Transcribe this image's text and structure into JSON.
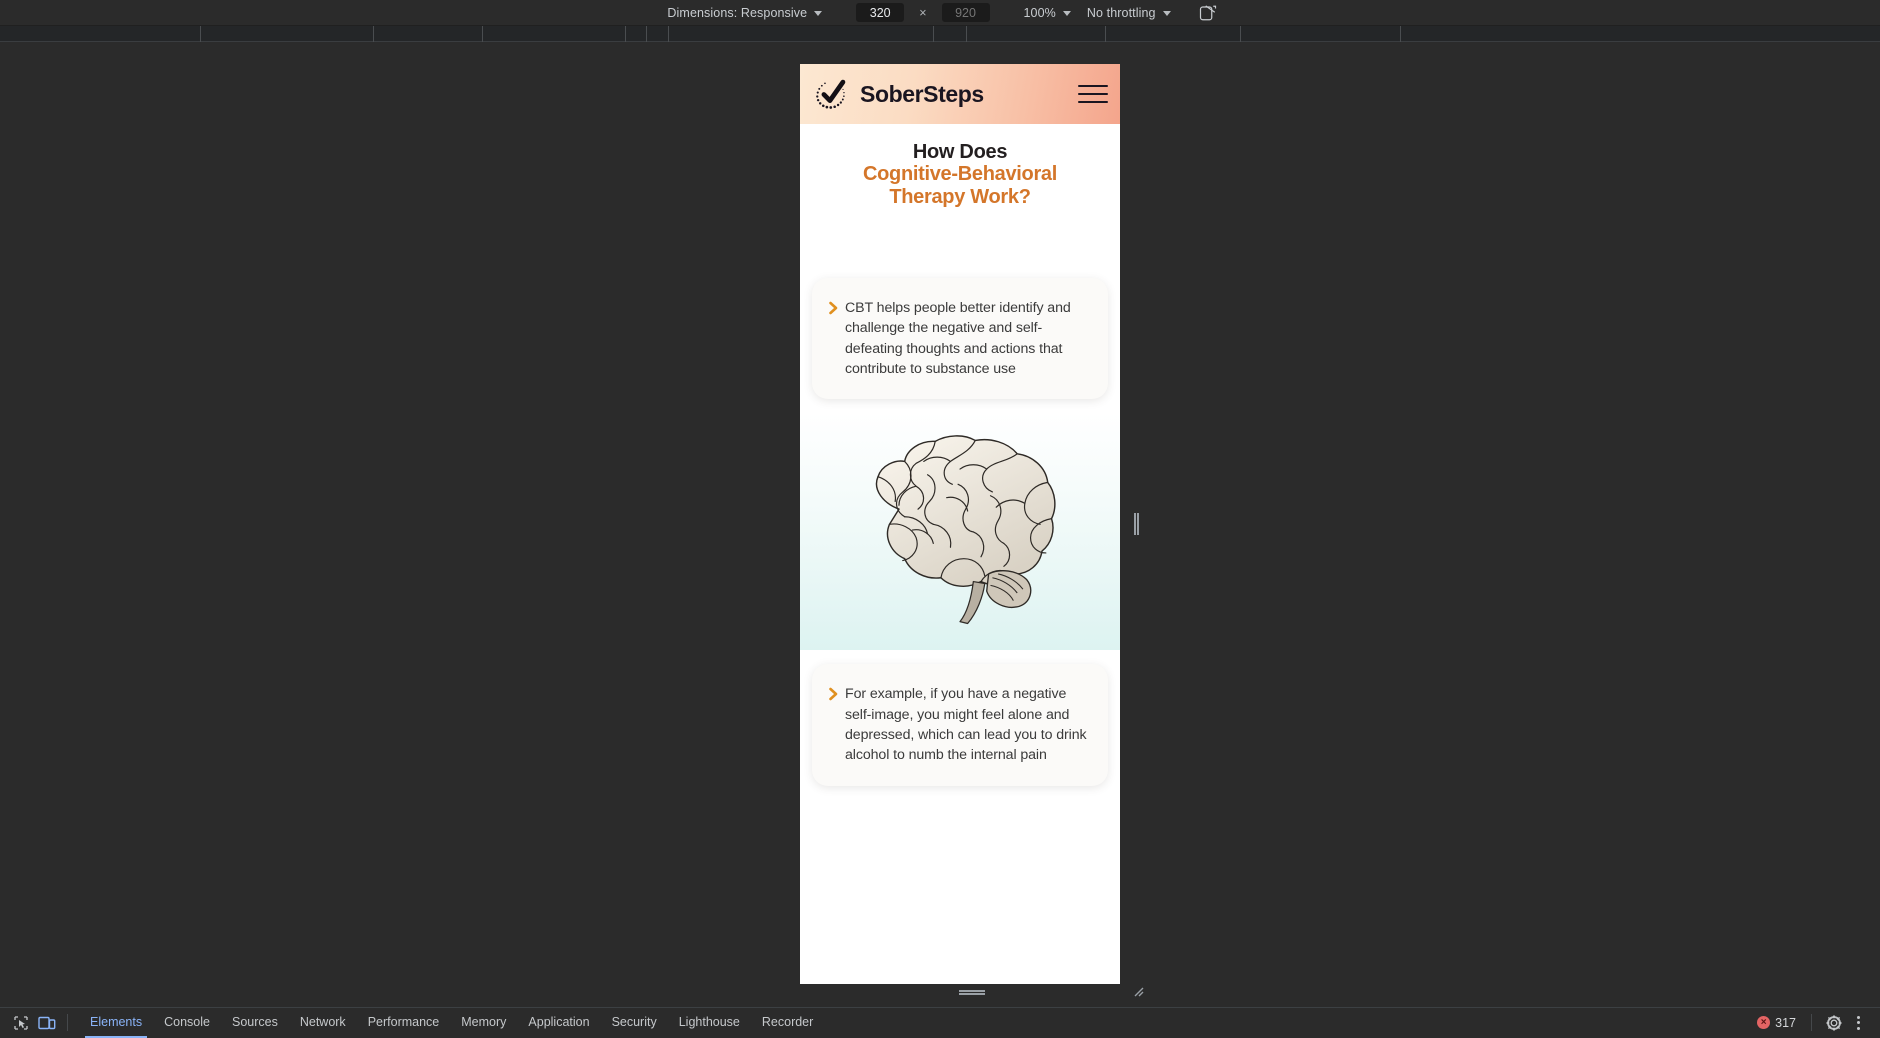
{
  "devtools": {
    "device_toolbar": {
      "dimensions_label": "Dimensions: Responsive",
      "width_value": "320",
      "height_placeholder": "920",
      "multiply_symbol": "×",
      "zoom_label": "100%",
      "throttling_label": "No throttling",
      "rotate_icon": "rotate-device-icon"
    },
    "bottom_bar": {
      "inspect_icon": "inspect-element-icon",
      "device_toolbar_icon": "toggle-device-toolbar-icon",
      "tabs": [
        {
          "label": "Elements",
          "active": true
        },
        {
          "label": "Console",
          "active": false
        },
        {
          "label": "Sources",
          "active": false
        },
        {
          "label": "Network",
          "active": false
        },
        {
          "label": "Performance",
          "active": false
        },
        {
          "label": "Memory",
          "active": false
        },
        {
          "label": "Application",
          "active": false
        },
        {
          "label": "Security",
          "active": false
        },
        {
          "label": "Lighthouse",
          "active": false
        },
        {
          "label": "Recorder",
          "active": false
        }
      ],
      "error_icon": "error-circle-icon",
      "error_count": "317",
      "settings_icon": "gear-icon",
      "more_icon": "kebab-menu-icon"
    }
  },
  "page": {
    "header": {
      "logo_icon": "checkmark-circle-logo-icon",
      "brand": "SoberSteps",
      "menu_icon": "hamburger-menu-icon",
      "gradient_from": "#fce8d2",
      "gradient_to": "#f4a58c"
    },
    "hero": {
      "line1": "How Does",
      "line2": "Cognitive-Behavioral",
      "line3": "Therapy Work?",
      "accent_color": "#d4762a"
    },
    "cards": [
      {
        "bullet_icon": "chevron-right-icon",
        "text": "CBT helps people better identify and challenge the negative and self-defeating thoughts and actions that contribute to substance use"
      },
      {
        "bullet_icon": "chevron-right-icon",
        "text": "For example, if you have a negative self-image, you might feel alone and depressed, which can lead you to drink alcohol to numb the internal pain"
      }
    ],
    "illustration": {
      "name": "brain-engraving-illustration",
      "gradient_from": "#ffffff",
      "gradient_to": "#ddf3f1"
    }
  }
}
